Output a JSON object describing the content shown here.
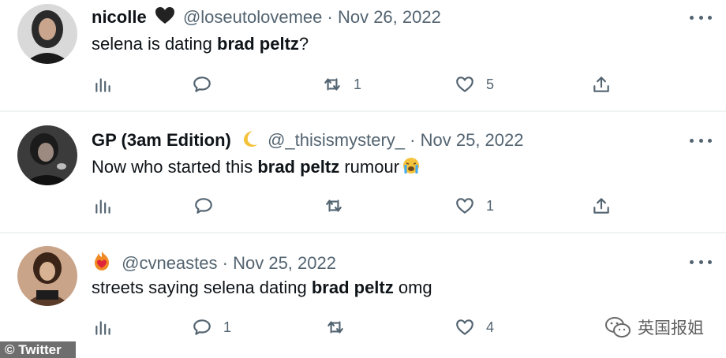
{
  "tweets": [
    {
      "display_name": "nicolle",
      "badge": "black-heart-emoji",
      "handle": "@loseutolovemee",
      "separator": "·",
      "date": "Nov 26, 2022",
      "text_before": "selena is dating ",
      "text_bold": "brad peltz",
      "text_after": "?",
      "replies": "",
      "retweets": "1",
      "likes": "5"
    },
    {
      "display_name": "GP (3am Edition)",
      "badge": "crescent-moon-emoji",
      "handle": "@_thisismystery_",
      "separator": "·",
      "date": "Nov 25, 2022",
      "text_before": "Now who started this ",
      "text_bold": "brad peltz",
      "text_after": " rumour",
      "trailing_emoji": "crying-face-emoji",
      "replies": "",
      "retweets": "",
      "likes": "1"
    },
    {
      "display_name": "",
      "badge": "heart-on-fire-emoji",
      "handle": "@cvneastes",
      "separator": "·",
      "date": "Nov 25, 2022",
      "text_before": "streets saying selena dating ",
      "text_bold": "brad peltz",
      "text_after": " omg",
      "replies": "1",
      "retweets": "",
      "likes": "4"
    }
  ],
  "watermark": {
    "source": "© Twitter",
    "wechat_account": "英国报姐"
  },
  "colors": {
    "text": "#0f1419",
    "secondary": "#536471",
    "divider": "#eff3f4"
  }
}
